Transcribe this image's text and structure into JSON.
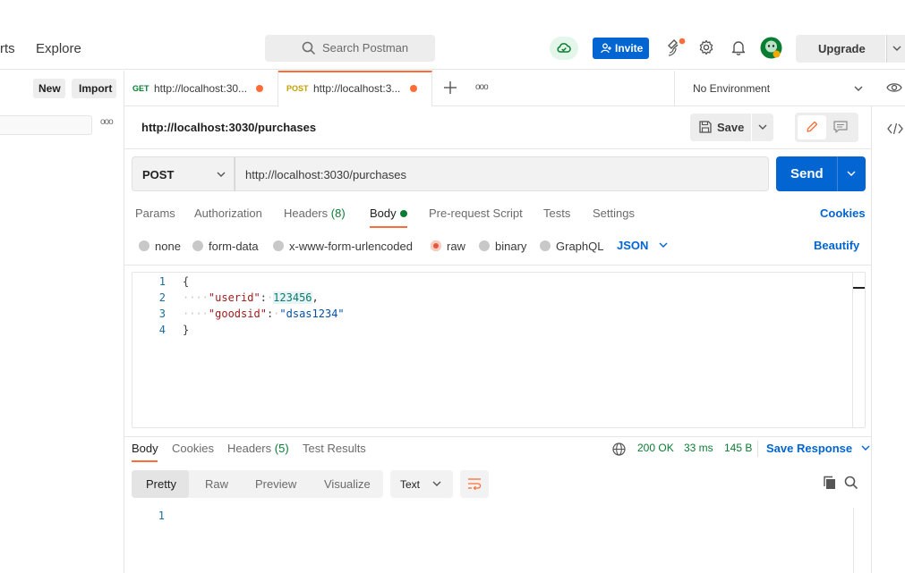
{
  "header": {
    "nav_partial": "rts",
    "nav_explore": "Explore",
    "search_placeholder": "Search Postman",
    "invite_label": "Invite",
    "upgrade_label": "Upgrade"
  },
  "sidebar": {
    "new_label": "New",
    "import_label": "Import",
    "more_label": "ooo"
  },
  "tabs": [
    {
      "method": "GET",
      "url": "http://localhost:30...",
      "method_color": "#0a7d33"
    },
    {
      "method": "POST",
      "url": "http://localhost:3...",
      "method_color": "#c4a000"
    }
  ],
  "tabs_more": "ooo",
  "environment": "No Environment",
  "request": {
    "title": "http://localhost:3030/purchases",
    "save_label": "Save",
    "method": "POST",
    "url": "http://localhost:3030/purchases",
    "send_label": "Send"
  },
  "request_tabs": {
    "params": "Params",
    "authorization": "Authorization",
    "headers": "Headers",
    "headers_count": "(8)",
    "body": "Body",
    "prerequest": "Pre-request Script",
    "tests": "Tests",
    "settings": "Settings",
    "cookies": "Cookies"
  },
  "body_types": {
    "none": "none",
    "form_data": "form-data",
    "urlencoded": "x-www-form-urlencoded",
    "raw": "raw",
    "binary": "binary",
    "graphql": "GraphQL",
    "format": "JSON",
    "beautify": "Beautify"
  },
  "editor": {
    "line_numbers": [
      "1",
      "2",
      "3",
      "4"
    ],
    "open_brace": "{",
    "close_brace": "}",
    "key1": "\"userid\"",
    "val1": "123456",
    "key2": "\"goodsid\"",
    "val2": "\"dsas1234\""
  },
  "response": {
    "tab_body": "Body",
    "tab_cookies": "Cookies",
    "tab_headers": "Headers",
    "headers_count": "(5)",
    "tab_tests": "Test Results",
    "status": "200 OK",
    "time": "33 ms",
    "size": "145 B",
    "save_response": "Save Response",
    "view_pretty": "Pretty",
    "view_raw": "Raw",
    "view_preview": "Preview",
    "view_visualize": "Visualize",
    "text_format": "Text",
    "line_number": "1"
  },
  "colors": {
    "accent": "#ff6c37",
    "primary": "#0265d2",
    "success": "#0a7d33"
  }
}
